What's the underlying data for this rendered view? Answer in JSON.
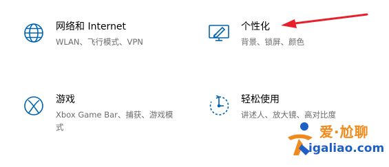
{
  "tiles": [
    {
      "title": "网络和 Internet",
      "desc": "WLAN、飞行模式、VPN",
      "icon": "globe-icon"
    },
    {
      "title": "个性化",
      "desc": "背景、锁屏、颜色",
      "icon": "personalization-icon"
    },
    {
      "title": "游戏",
      "desc": "Xbox Game Bar、捕获、游戏模式",
      "icon": "xbox-icon"
    },
    {
      "title": "轻松使用",
      "desc": "讲述人、放大镜、高对比度",
      "icon": "ease-of-access-icon"
    }
  ],
  "watermark": {
    "text_cn": "爱·尬聊",
    "url": "igaliao.com"
  },
  "colors": {
    "accent": "#0063b1",
    "arrow": "#e8202a",
    "watermark_orange": "#f08a1c",
    "watermark_blue": "#1f5fc4"
  }
}
